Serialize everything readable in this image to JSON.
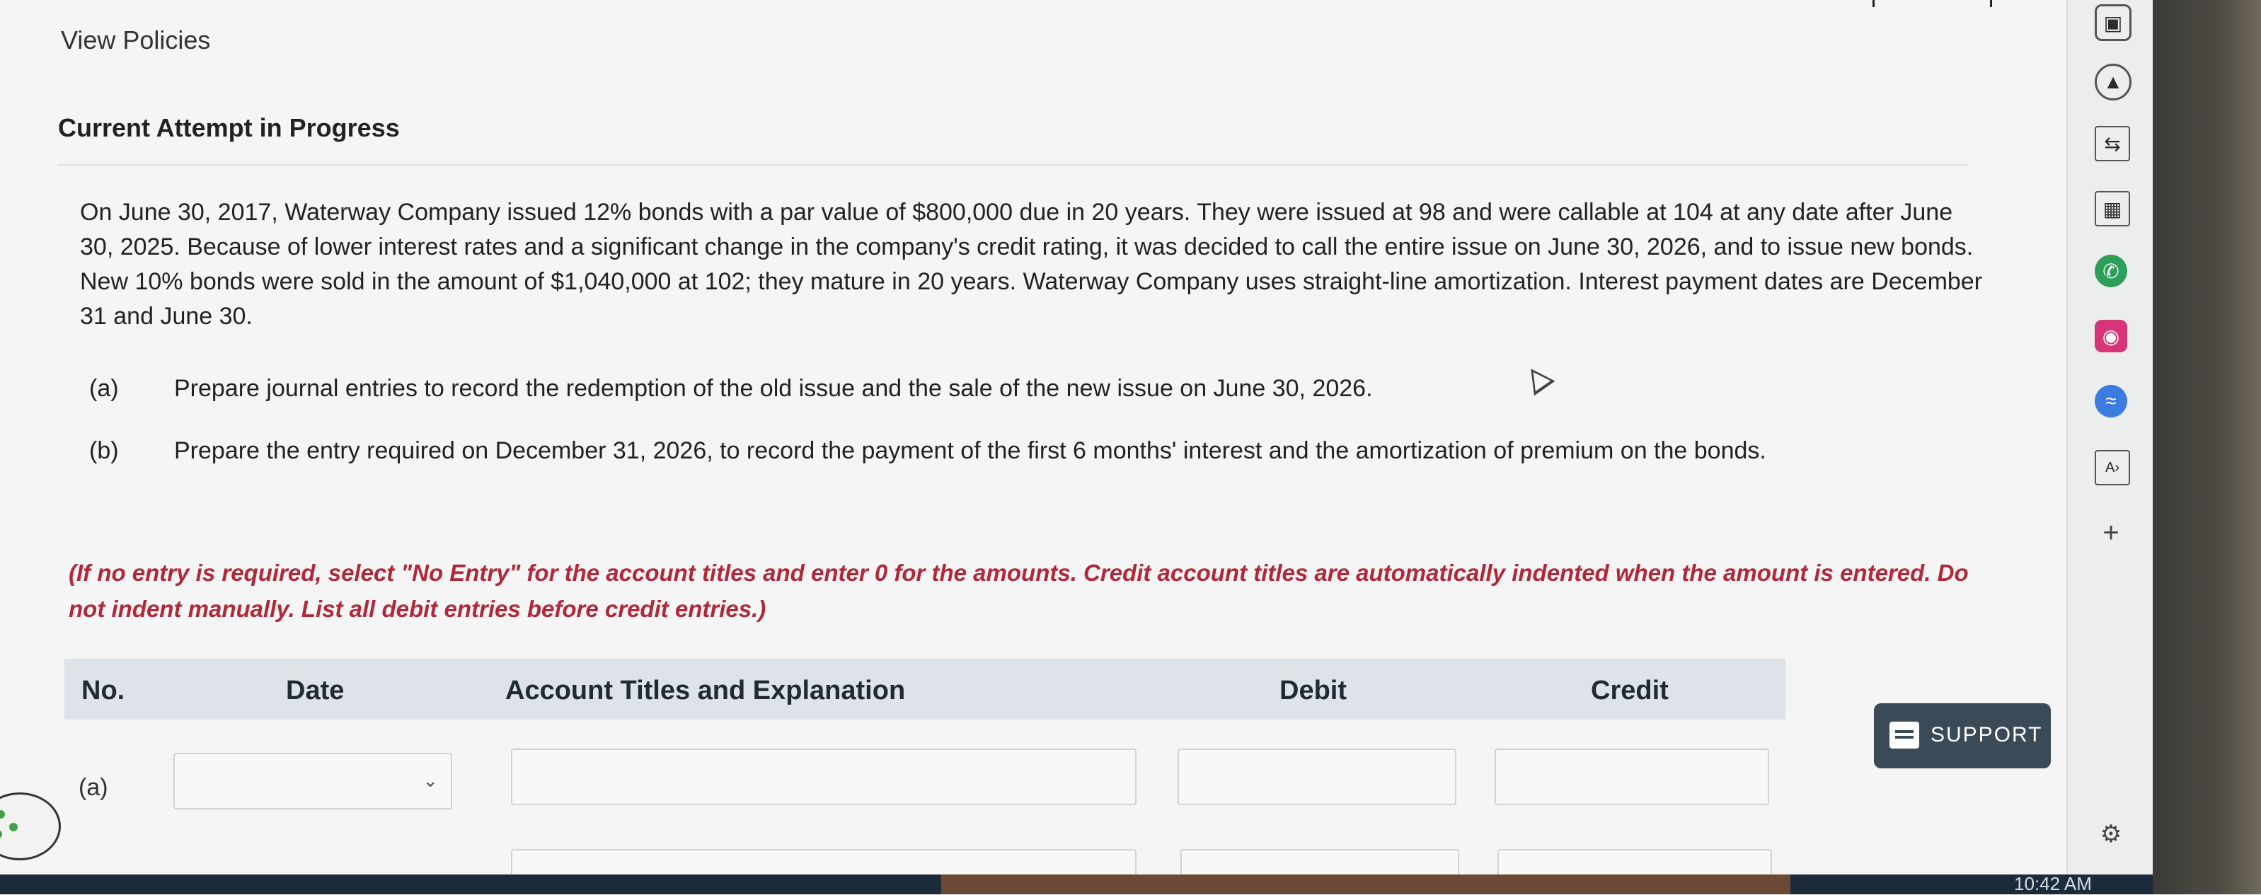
{
  "header": {
    "policies_link": "View Policies",
    "attempt_title": "Current Attempt in Progress"
  },
  "problem": {
    "text": "On June 30, 2017, Waterway Company issued 12% bonds with a par value of $800,000 due in 20 years. They were issued at 98 and were callable at 104 at any date after June 30, 2025. Because of lower interest rates and a significant change in the company's credit rating, it was decided to call the entire issue on June 30, 2026, and to issue new bonds. New 10% bonds were sold in the amount of $1,040,000 at 102; they mature in 20 years. Waterway Company uses straight-line amortization. Interest payment dates are December 31 and June 30.",
    "parts": [
      {
        "label": "(a)",
        "text": "Prepare journal entries to record the redemption of the old issue and the sale of the new issue on June 30, 2026."
      },
      {
        "label": "(b)",
        "text": "Prepare the entry required on December 31, 2026, to record the payment of the first 6 months' interest and the amortization of premium on the bonds."
      }
    ],
    "instructions": "(If no entry is required, select \"No Entry\" for the account titles and enter 0 for the amounts. Credit account titles are automatically indented when the amount is entered. Do not indent manually. List all debit entries before credit entries.)"
  },
  "table": {
    "headers": {
      "no": "No.",
      "date": "Date",
      "account": "Account Titles and Explanation",
      "debit": "Debit",
      "credit": "Credit"
    },
    "rows": [
      {
        "no": "(a)",
        "date": "",
        "account": "",
        "debit": "",
        "credit": ""
      }
    ]
  },
  "support": {
    "label": "SUPPORT"
  },
  "sidebar": {
    "add_label": "+"
  },
  "taskbar": {
    "clock": "10:42 AM"
  },
  "colors": {
    "accent_red": "#b0283a",
    "support_bg": "#3b4a57",
    "header_bg": "#dde3e8"
  }
}
